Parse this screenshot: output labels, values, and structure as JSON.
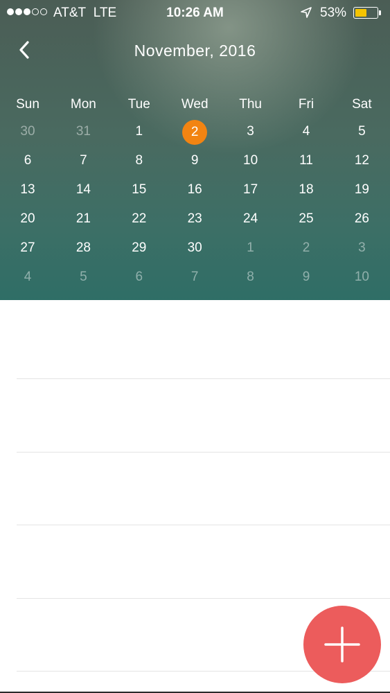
{
  "status_bar": {
    "carrier": "AT&T",
    "network": "LTE",
    "time": "10:26 AM",
    "battery_percent": "53%",
    "battery_level": 0.53,
    "signal_bars_filled": 3,
    "signal_bars_total": 5,
    "icons": [
      "signal-dots-icon",
      "location-arrow-icon",
      "battery-icon"
    ],
    "battery_color": "#f5c400"
  },
  "header": {
    "back_icon": "chevron-left-icon",
    "title": "November, 2016"
  },
  "calendar": {
    "weekdays": [
      "Sun",
      "Mon",
      "Tue",
      "Wed",
      "Thu",
      "Fri",
      "Sat"
    ],
    "weeks": [
      [
        {
          "d": "30",
          "muted": true
        },
        {
          "d": "31",
          "muted": true
        },
        {
          "d": "1"
        },
        {
          "d": "2",
          "today": true
        },
        {
          "d": "3"
        },
        {
          "d": "4"
        },
        {
          "d": "5"
        }
      ],
      [
        {
          "d": "6"
        },
        {
          "d": "7"
        },
        {
          "d": "8"
        },
        {
          "d": "9"
        },
        {
          "d": "10"
        },
        {
          "d": "11"
        },
        {
          "d": "12"
        }
      ],
      [
        {
          "d": "13"
        },
        {
          "d": "14"
        },
        {
          "d": "15"
        },
        {
          "d": "16"
        },
        {
          "d": "17"
        },
        {
          "d": "18"
        },
        {
          "d": "19"
        }
      ],
      [
        {
          "d": "20"
        },
        {
          "d": "21"
        },
        {
          "d": "22"
        },
        {
          "d": "23"
        },
        {
          "d": "24"
        },
        {
          "d": "25"
        },
        {
          "d": "26"
        }
      ],
      [
        {
          "d": "27"
        },
        {
          "d": "28"
        },
        {
          "d": "29"
        },
        {
          "d": "30"
        },
        {
          "d": "1",
          "muted": true
        },
        {
          "d": "2",
          "muted": true
        },
        {
          "d": "3",
          "muted": true
        }
      ],
      [
        {
          "d": "4",
          "muted": true
        },
        {
          "d": "5",
          "muted": true
        },
        {
          "d": "6",
          "muted": true
        },
        {
          "d": "7",
          "muted": true
        },
        {
          "d": "8",
          "muted": true
        },
        {
          "d": "9",
          "muted": true
        },
        {
          "d": "10",
          "muted": true
        }
      ]
    ],
    "today_color": "#f28412"
  },
  "event_list": {
    "row_count": 5
  },
  "fab": {
    "icon": "plus-icon",
    "color": "#ec5c5c"
  }
}
